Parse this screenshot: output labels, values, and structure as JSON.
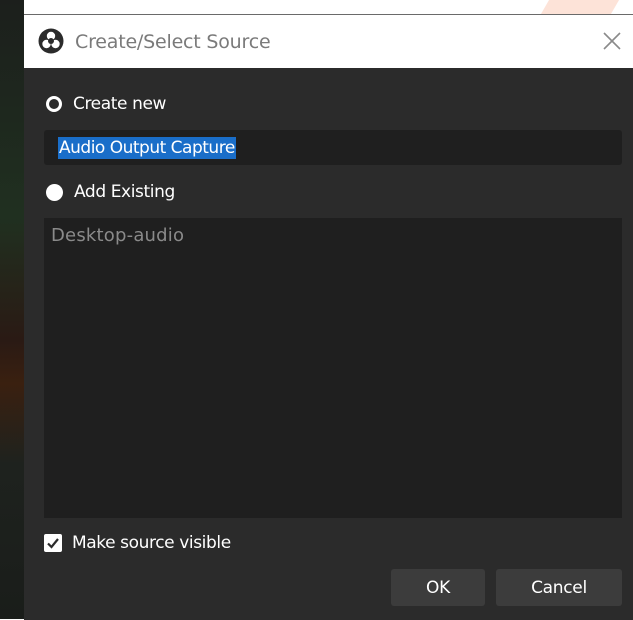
{
  "dialog": {
    "title": "Create/Select Source",
    "create_new_label": "Create new",
    "source_name_value": "Audio Output Capture",
    "add_existing_label": "Add Existing",
    "existing_sources": [
      "Desktop-audio"
    ],
    "make_visible_label": "Make source visible",
    "make_visible_checked": true,
    "ok_label": "OK",
    "cancel_label": "Cancel"
  },
  "icons": {
    "app": "obs-logo-icon",
    "close": "close-icon",
    "check": "checkmark-icon"
  },
  "colors": {
    "dialog_bg": "#2b2b2b",
    "input_bg": "#1f1f1f",
    "selection": "#1a6ec9",
    "button_bg": "#3c3c3c",
    "title_bar_bg": "#ffffff"
  }
}
